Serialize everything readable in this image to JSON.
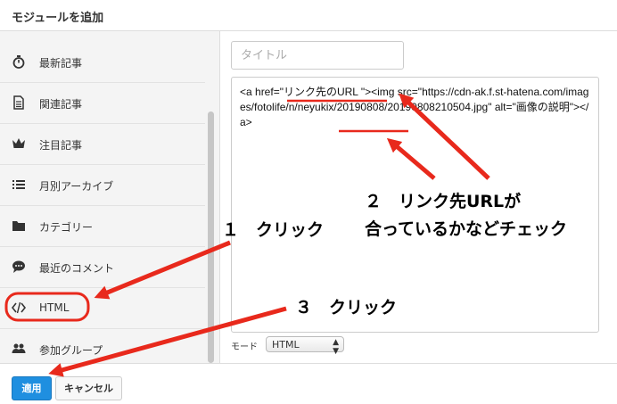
{
  "dialog": {
    "title": "モジュールを追加"
  },
  "sidebar": {
    "items": [
      {
        "label": "最新記事",
        "icon": "stopwatch-icon"
      },
      {
        "label": "関連記事",
        "icon": "document-icon"
      },
      {
        "label": "注目記事",
        "icon": "crown-icon"
      },
      {
        "label": "月別アーカイブ",
        "icon": "list-icon"
      },
      {
        "label": "カテゴリー",
        "icon": "folder-icon"
      },
      {
        "label": "最近のコメント",
        "icon": "comment-bubble-icon"
      },
      {
        "label": "HTML",
        "icon": "code-icon"
      },
      {
        "label": "参加グループ",
        "icon": "group-icon"
      }
    ]
  },
  "form": {
    "title_placeholder": "タイトル",
    "code": "<a href=\"リンク先のURL \"><img src=\"https://cdn-ak.f.st-hatena.com/images/fotolife/n/neyukix/20190808/20190808210504.jpg\" alt=\"画像の説明\"></a>",
    "mode_label": "モード",
    "mode_value": "HTML"
  },
  "footer": {
    "apply_label": "適用",
    "cancel_label": "キャンセル"
  },
  "annotations": {
    "step1": "１　クリック",
    "step2_line1": "２　リンク先URLが",
    "step2_line2": "合っているかなどチェック",
    "step3": "３　クリック"
  },
  "colors": {
    "annotation_red": "#e8291c",
    "apply_blue": "#1f8fe0"
  }
}
